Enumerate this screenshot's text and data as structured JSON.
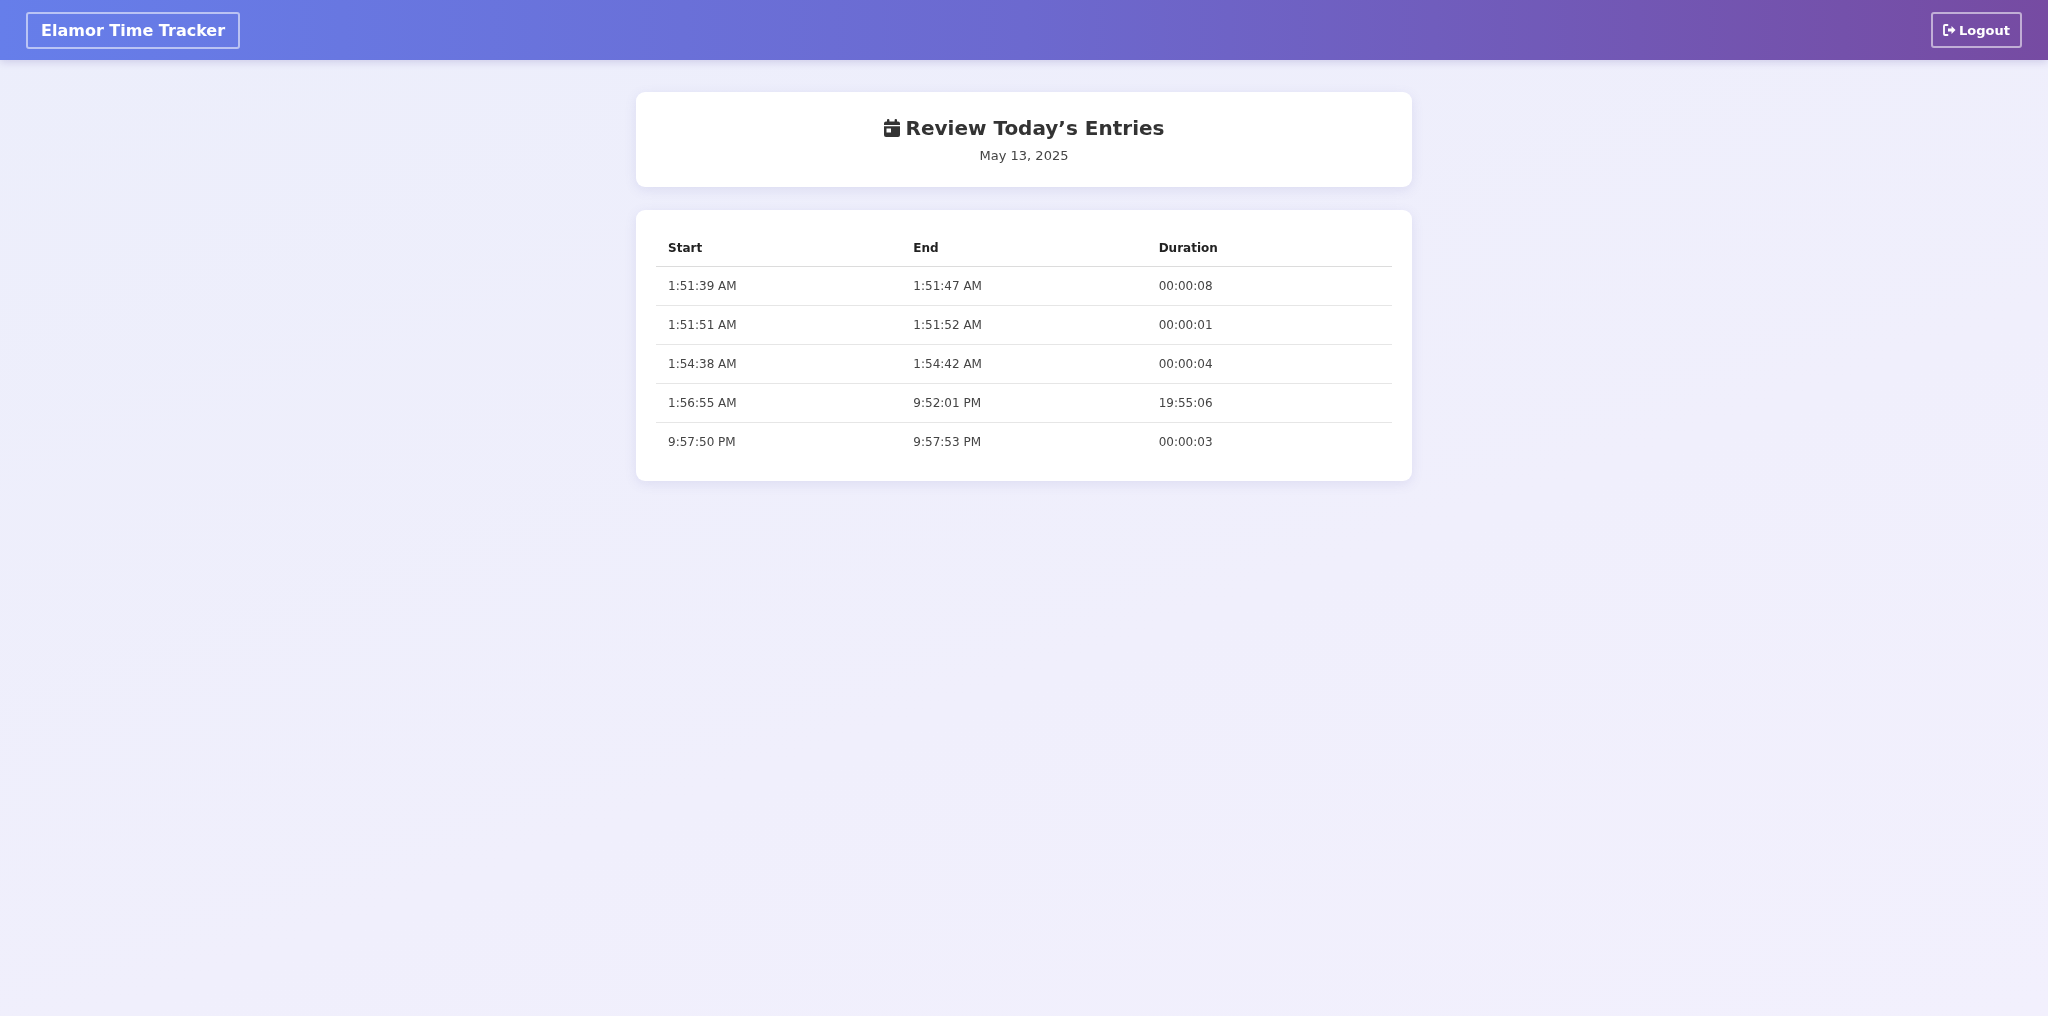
{
  "header": {
    "brand": "Elamor Time Tracker",
    "logout": "Logout"
  },
  "summary": {
    "title": "Review Today’s Entries",
    "date": "May 13, 2025"
  },
  "table": {
    "columns": [
      "Start",
      "End",
      "Duration"
    ],
    "rows": [
      [
        "1:51:39 AM",
        "1:51:47 AM",
        "00:00:08"
      ],
      [
        "1:51:51 AM",
        "1:51:52 AM",
        "00:00:01"
      ],
      [
        "1:54:38 AM",
        "1:54:42 AM",
        "00:00:04"
      ],
      [
        "1:56:55 AM",
        "9:52:01 PM",
        "19:55:06"
      ],
      [
        "9:57:50 PM",
        "9:57:53 PM",
        "00:00:03"
      ]
    ]
  }
}
